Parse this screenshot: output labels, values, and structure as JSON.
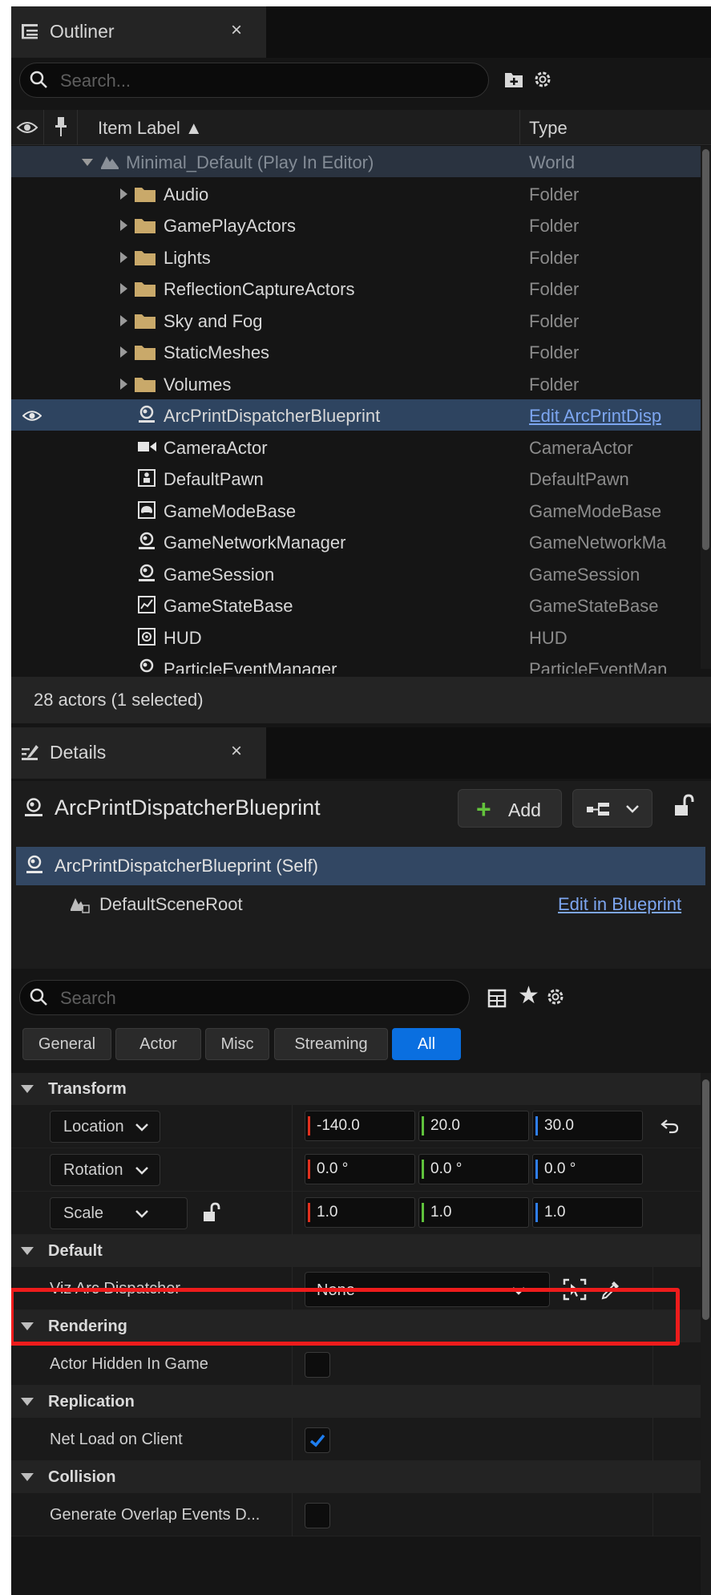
{
  "outliner": {
    "tab_label": "Outliner",
    "close_glyph": "×",
    "search_placeholder": "Search...",
    "header": {
      "item_label": "Item Label ▲",
      "type": "Type"
    },
    "rows": [
      {
        "label": "Minimal_Default (Play In Editor)",
        "type": "World"
      },
      {
        "label": "Audio",
        "type": "Folder"
      },
      {
        "label": "GamePlayActors",
        "type": "Folder"
      },
      {
        "label": "Lights",
        "type": "Folder"
      },
      {
        "label": "ReflectionCaptureActors",
        "type": "Folder"
      },
      {
        "label": "Sky and Fog",
        "type": "Folder"
      },
      {
        "label": "StaticMeshes",
        "type": "Folder"
      },
      {
        "label": "Volumes",
        "type": "Folder"
      },
      {
        "label": "ArcPrintDispatcherBlueprint",
        "type": "Edit ArcPrintDisp"
      },
      {
        "label": "CameraActor",
        "type": "CameraActor"
      },
      {
        "label": "DefaultPawn",
        "type": "DefaultPawn"
      },
      {
        "label": "GameModeBase",
        "type": "GameModeBase"
      },
      {
        "label": "GameNetworkManager",
        "type": "GameNetworkMa"
      },
      {
        "label": "GameSession",
        "type": "GameSession"
      },
      {
        "label": "GameStateBase",
        "type": "GameStateBase"
      },
      {
        "label": "HUD",
        "type": "HUD"
      },
      {
        "label": "ParticleEventManager",
        "type": "ParticleEventMan"
      }
    ],
    "status": "28 actors (1 selected)"
  },
  "details": {
    "tab_label": "Details",
    "close_glyph": "×",
    "actor_name": "ArcPrintDispatcherBlueprint",
    "add_label": "Add",
    "components": {
      "self": "ArcPrintDispatcherBlueprint (Self)",
      "root": "DefaultSceneRoot",
      "edit_link": "Edit in Blueprint"
    },
    "search_placeholder": "Search",
    "filters": [
      "General",
      "Actor",
      "Misc",
      "Streaming",
      "All"
    ],
    "active_filter": "All",
    "transform": {
      "title": "Transform",
      "location": {
        "label": "Location",
        "x": "-140.0",
        "y": "20.0",
        "z": "30.0"
      },
      "rotation": {
        "label": "Rotation",
        "x": "0.0 °",
        "y": "0.0 °",
        "z": "0.0 °"
      },
      "scale": {
        "label": "Scale",
        "x": "1.0",
        "y": "1.0",
        "z": "1.0"
      }
    },
    "default": {
      "title": "Default",
      "viz_label": "Viz Arc Dispatcher",
      "viz_value": "None"
    },
    "rendering": {
      "title": "Rendering",
      "hidden_label": "Actor Hidden In Game",
      "hidden_checked": false
    },
    "replication": {
      "title": "Replication",
      "net_label": "Net Load on Client",
      "net_checked": true
    },
    "collision": {
      "title": "Collision",
      "overlap_label": "Generate Overlap Events D...",
      "overlap_checked": false
    }
  },
  "colors": {
    "accent": "#0a6fe0",
    "highlight": "#ee1c1c",
    "x_axis": "#e0301e",
    "y_axis": "#5fc23c",
    "z_axis": "#2f7ff0",
    "link": "#7da6f0"
  }
}
